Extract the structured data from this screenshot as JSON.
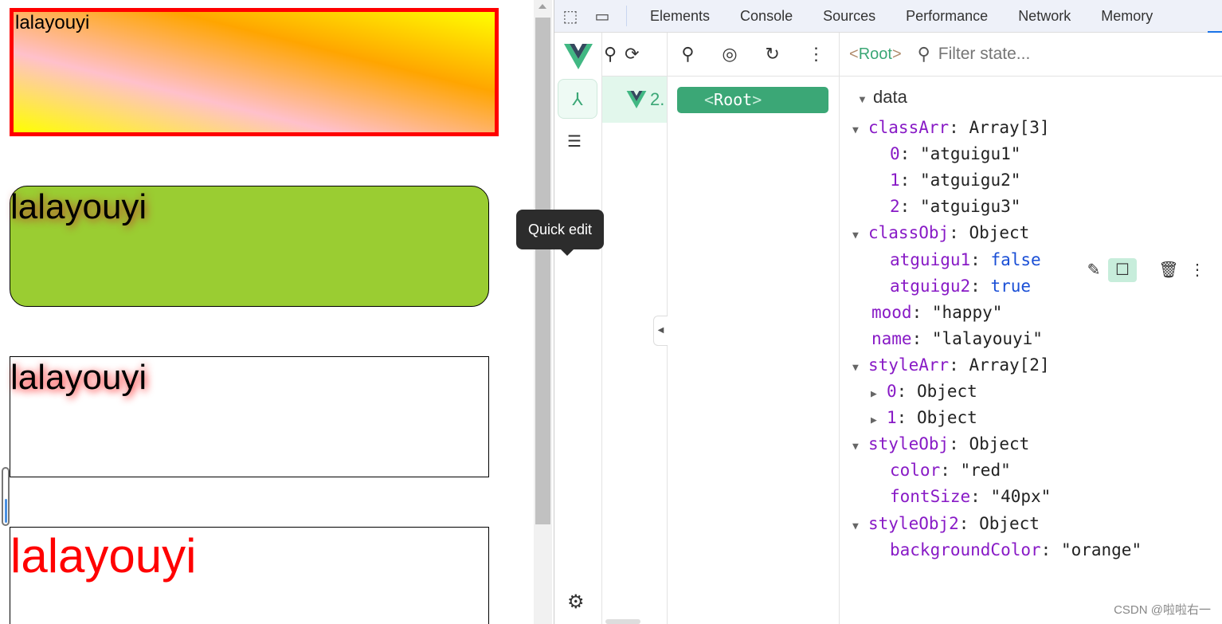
{
  "page": {
    "boxes": [
      "lalayouyi",
      "lalayouyi",
      "lalayouyi",
      "lalayouyi"
    ]
  },
  "devtools": {
    "tabs": [
      "Elements",
      "Console",
      "Sources",
      "Performance",
      "Network",
      "Memory"
    ],
    "icons": {
      "inspect": "inspect-element-icon",
      "device": "device-toolbar-icon"
    }
  },
  "vue": {
    "app_label": "2.",
    "root_chip": "Root",
    "inspector_tag": "Root",
    "filter_placeholder": "Filter state...",
    "section": "data",
    "tooltip": "Quick edit",
    "accent": "#3ba776",
    "state": [
      {
        "indent": 0,
        "tri": "down",
        "key": "classArr",
        "val": "Array[3]",
        "type": "plain"
      },
      {
        "indent": 1,
        "key": "0",
        "val": "\"atguigu1\"",
        "type": "str"
      },
      {
        "indent": 1,
        "key": "1",
        "val": "\"atguigu2\"",
        "type": "str"
      },
      {
        "indent": 1,
        "key": "2",
        "val": "\"atguigu3\"",
        "type": "str"
      },
      {
        "indent": 0,
        "tri": "down",
        "key": "classObj",
        "val": "Object",
        "type": "plain"
      },
      {
        "indent": 1,
        "key": "atguigu1",
        "val": "false",
        "type": "bool"
      },
      {
        "indent": 1,
        "key": "atguigu2",
        "val": "true",
        "type": "bool"
      },
      {
        "indent": 0,
        "key": "mood",
        "val": "\"happy\"",
        "type": "str"
      },
      {
        "indent": 0,
        "key": "name",
        "val": "\"lalayouyi\"",
        "type": "str"
      },
      {
        "indent": 0,
        "tri": "down",
        "key": "styleArr",
        "val": "Array[2]",
        "type": "plain"
      },
      {
        "indent": 1,
        "tri": "right",
        "key": "0",
        "val": "Object",
        "type": "plain"
      },
      {
        "indent": 1,
        "tri": "right",
        "key": "1",
        "val": "Object",
        "type": "plain"
      },
      {
        "indent": 0,
        "tri": "down",
        "key": "styleObj",
        "val": "Object",
        "type": "plain"
      },
      {
        "indent": 1,
        "key": "color",
        "val": "\"red\"",
        "type": "str"
      },
      {
        "indent": 1,
        "key": "fontSize",
        "val": "\"40px\"",
        "type": "str"
      },
      {
        "indent": 0,
        "tri": "down",
        "key": "styleObj2",
        "val": "Object",
        "type": "plain"
      },
      {
        "indent": 1,
        "key": "backgroundColor",
        "val": "\"orange\"",
        "type": "str"
      }
    ]
  },
  "watermark": "CSDN @啦啦右一"
}
